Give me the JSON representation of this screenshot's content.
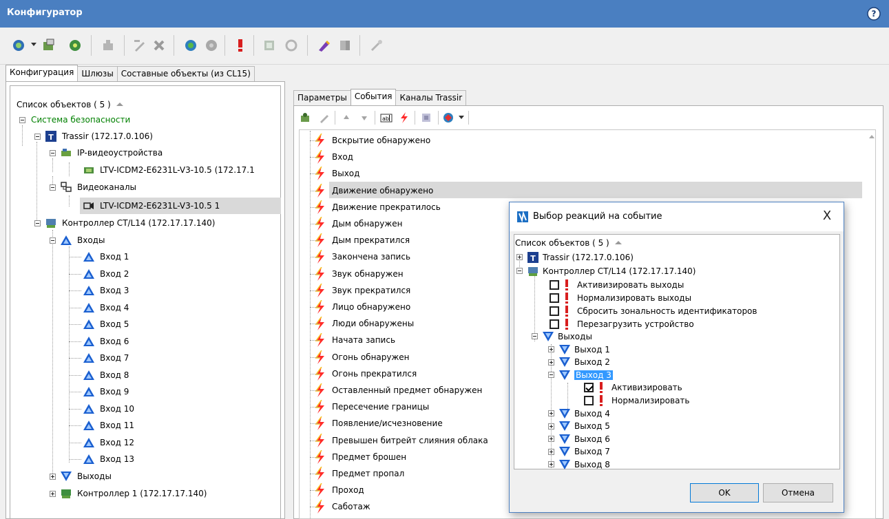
{
  "app": {
    "title": "Конфигуратор"
  },
  "top_tabs": [
    "Конфигурация",
    "Шлюзы",
    "Составные объекты (из CL15)"
  ],
  "left_panel": {
    "header": "Список объектов ( 5 )",
    "root": "Система безопасности",
    "trassir": "Trassir (172.17.0.106)",
    "ip_devices": "IP-видеоустройства",
    "ip_device_item": "LTV-ICDM2-E6231L-V3-10.5 (172.17.1",
    "video_channels": "Видеоканалы",
    "video_channel_item": "LTV-ICDM2-E6231L-V3-10.5 1",
    "controller": "Контроллер CT/L14 (172.17.17.140)",
    "inputs": "Входы",
    "input_items": [
      "Вход 1",
      "Вход 2",
      "Вход 3",
      "Вход 4",
      "Вход 5",
      "Вход 6",
      "Вход 7",
      "Вход 8",
      "Вход 9",
      "Вход 10",
      "Вход 11",
      "Вход 12",
      "Вход 13"
    ],
    "outputs": "Выходы",
    "controller1": "Контроллер 1 (172.17.17.140)"
  },
  "right_tabs": [
    "Параметры",
    "События",
    "Каналы Trassir"
  ],
  "events": [
    "Вскрытие обнаружено",
    "Вход",
    "Выход",
    "Движение обнаружено",
    "Движение прекратилось",
    "Дым обнаружен",
    "Дым прекратился",
    "Закончена запись",
    "Звук обнаружен",
    "Звук прекратился",
    "Лицо обнаружено",
    "Люди обнаружены",
    "Начата запись",
    "Огонь обнаружен",
    "Огонь прекратился",
    "Оставленный предмет обнаружен",
    "Пересечение границы",
    "Появление/исчезновение",
    "Превышен битрейт слияния облака",
    "Предмет брошен",
    "Предмет пропал",
    "Проход",
    "Саботаж"
  ],
  "dialog": {
    "title": "Выбор реакций на событие",
    "close": "X",
    "header": "Список объектов ( 5 )",
    "trassir": "Trassir (172.17.0.106)",
    "controller": "Контроллер CT/L14 (172.17.17.140)",
    "actions": [
      "Активизировать выходы",
      "Нормализировать выходы",
      "Сбросить зональность идентификаторов",
      "Перезагрузить устройство"
    ],
    "outputs": "Выходы",
    "output_items": [
      "Выход 1",
      "Выход 2",
      "Выход 3",
      "Выход 4",
      "Выход 5",
      "Выход 6",
      "Выход 7",
      "Выход 8"
    ],
    "sub_actions": [
      "Активизировать",
      "Нормализировать"
    ],
    "ok": "OK",
    "cancel": "Отмена"
  },
  "colors": {
    "titlebar": "#4a7fc1",
    "root_text": "#008000",
    "selection": "#3399ff",
    "bolt": "#ff2a2a"
  }
}
